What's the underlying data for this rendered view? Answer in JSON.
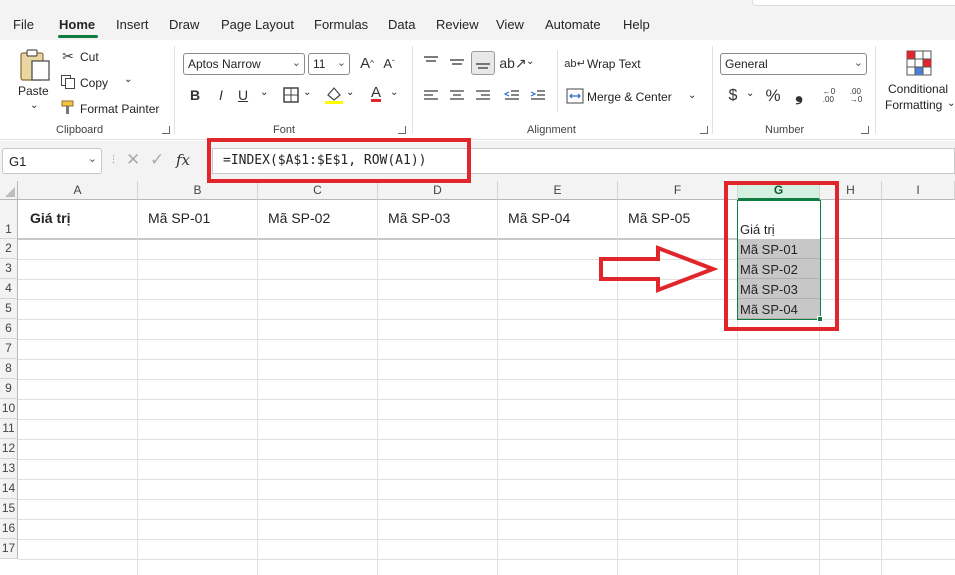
{
  "menu": {
    "tabs": [
      "File",
      "Home",
      "Insert",
      "Draw",
      "Page Layout",
      "Formulas",
      "Data",
      "Review",
      "View",
      "Automate",
      "Help"
    ],
    "active_tab": "Home"
  },
  "ribbon": {
    "clipboard": {
      "paste": "Paste",
      "cut": "Cut",
      "copy": "Copy",
      "format_painter": "Format Painter",
      "group": "Clipboard"
    },
    "font": {
      "name": "Aptos Narrow",
      "size": "11",
      "bold": "B",
      "italic": "I",
      "underline": "U",
      "font_color_glyph": "A",
      "group": "Font"
    },
    "alignment": {
      "wrap_text": "Wrap Text",
      "merge_center": "Merge & Center",
      "group": "Alignment"
    },
    "number": {
      "format": "General",
      "currency": "$",
      "percent": "%",
      "comma": "❟",
      "group": "Number"
    },
    "styles": {
      "conditional_line1": "Conditional",
      "conditional_line2": "Formatting"
    }
  },
  "formula_bar": {
    "name_box": "G1",
    "fx": "fx",
    "formula": "=INDEX($A$1:$E$1, ROW(A1))"
  },
  "sheet": {
    "columns": [
      "A",
      "B",
      "C",
      "D",
      "E",
      "F",
      "G",
      "H",
      "I"
    ],
    "rows": [
      "1",
      "2",
      "3",
      "4",
      "5",
      "6",
      "7",
      "8",
      "9",
      "10",
      "11",
      "12",
      "13",
      "14",
      "15",
      "16",
      "17"
    ],
    "row1": [
      "Giá trị",
      "Mã SP-01",
      "Mã SP-02",
      "Mã SP-03",
      "Mã SP-04",
      "Mã SP-05"
    ],
    "g_column": [
      "Giá trị",
      "Mã SP-01",
      "Mã SP-02",
      "Mã SP-03",
      "Mã SP-04"
    ]
  },
  "colors": {
    "excel_green": "#107c41",
    "annotation_red": "#e0262b"
  }
}
